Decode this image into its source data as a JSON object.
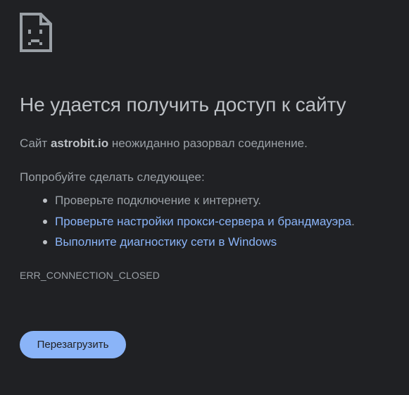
{
  "error_page": {
    "icon": "sad-page-icon",
    "title": "Не удается получить доступ к сайту",
    "summary": {
      "prefix": "Сайт ",
      "host": "astrobit.io",
      "suffix": " неожиданно разорвал соединение."
    },
    "suggestions_heading": "Попробуйте сделать следующее:",
    "suggestions": [
      {
        "text": "Проверьте подключение к интернету.",
        "link": false
      },
      {
        "text": "Проверьте настройки прокси-сервера и брандмауэра",
        "trailing": ".",
        "link": true
      },
      {
        "text": "Выполните диагностику сети в Windows",
        "link": true
      }
    ],
    "error_code": "ERR_CONNECTION_CLOSED",
    "reload_button": "Перезагрузить"
  },
  "colors": {
    "background": "#202124",
    "title": "#bdc1c6",
    "text": "#9aa0a6",
    "link": "#8ab4f8",
    "button": "#8ab4f8"
  }
}
